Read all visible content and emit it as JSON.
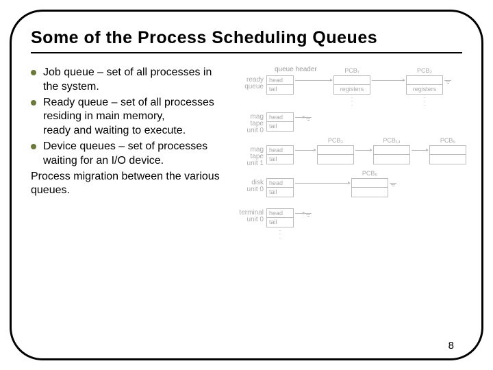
{
  "title": "Some of the Process Scheduling Queues",
  "bullets": [
    "Job queue – set of all processes in the system.",
    "Ready queue – set of all processes residing in main memory,\nready and waiting to execute.",
    "Device queues – set of processes waiting for an I/O device."
  ],
  "closing": "Process migration between the various queues.",
  "page_number": "8",
  "diagram": {
    "queue_header_label": "queue header",
    "head": "head",
    "tail": "tail",
    "registers": "registers",
    "queues": [
      {
        "label": "ready\nqueue",
        "pcb_labels": [
          "PCB₇",
          "PCB₂"
        ],
        "show_registers": true
      },
      {
        "label": "mag\ntape\nunit 0",
        "pcb_labels": []
      },
      {
        "label": "mag\ntape\nunit 1",
        "pcb_labels": [
          "PCB₃",
          "PCB₁₄",
          "PCB₆"
        ]
      },
      {
        "label": "disk\nunit 0",
        "pcb_labels": [
          "PCB₅"
        ]
      },
      {
        "label": "terminal\nunit 0",
        "pcb_labels": []
      }
    ]
  }
}
